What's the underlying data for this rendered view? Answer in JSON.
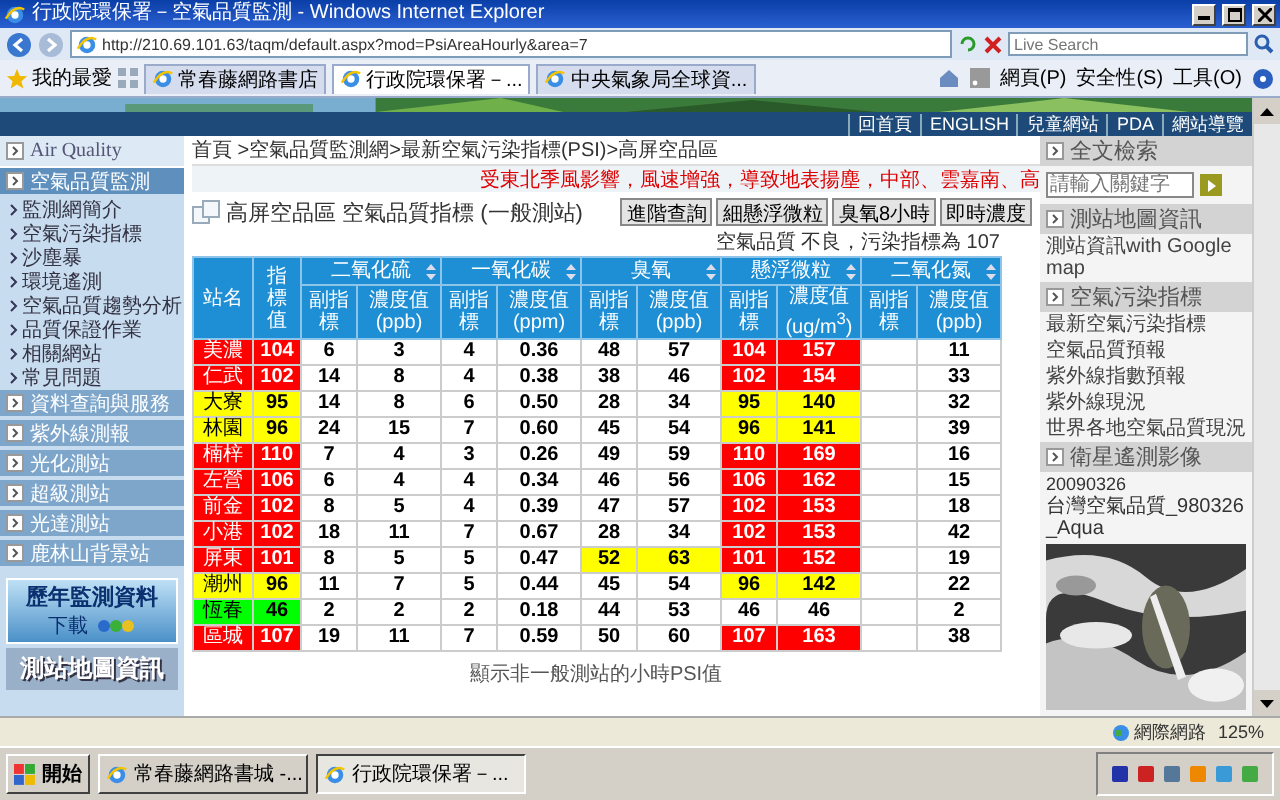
{
  "window": {
    "title": "行政院環保署－空氣品質監測 - Windows Internet Explorer"
  },
  "address_bar": {
    "url": "http://210.69.101.63/taqm/default.aspx?mod=PsiAreaHourly&area=7",
    "search_placeholder": "Live Search"
  },
  "favorites": {
    "label": "我的最愛"
  },
  "tabs": [
    {
      "label": "常春藤網路書店",
      "selected": false
    },
    {
      "label": "行政院環保署－...",
      "selected": true
    },
    {
      "label": "中央氣象局全球資...",
      "selected": false
    }
  ],
  "command_bar": [
    "網頁(P)",
    "安全性(S)",
    "工具(O)"
  ],
  "top_nav": [
    "回首頁",
    "ENGLISH",
    "兒童網站",
    "PDA",
    "網站導覽"
  ],
  "sidebar": {
    "title": "Air Quality",
    "items": [
      {
        "label": "空氣品質監測",
        "selected": true,
        "children": [
          "監測網簡介",
          "空氣污染指標",
          "沙塵暴",
          "環境遙測",
          "空氣品質趨勢分析",
          "品質保證作業",
          "相關網站",
          "常見問題"
        ]
      },
      {
        "label": "資料查詢與服務",
        "selected": false
      },
      {
        "label": "紫外線測報",
        "selected": false
      },
      {
        "label": "光化測站",
        "selected": false
      },
      {
        "label": "超級測站",
        "selected": false
      },
      {
        "label": "光達測站",
        "selected": false
      },
      {
        "label": "鹿林山背景站",
        "selected": false
      }
    ],
    "banners": [
      {
        "title": "歷年監測資料",
        "subtitle": "下載"
      },
      {
        "title": "測站地圖資訊"
      }
    ]
  },
  "breadcrumb": "首頁 >空氣品質監測網>最新空氣污染指標(PSI)>高屏空品區",
  "notice": "受東北季風影響，風速增強，導致地表揚塵，中部、雲嘉南、高",
  "heading": "高屏空品區 空氣品質指標 (一般測站)",
  "buttons": [
    "進階查詢",
    "細懸浮微粒",
    "臭氧8小時",
    "即時濃度"
  ],
  "summary": "空氣品質 不良，污染指標為 107",
  "table": {
    "station_header": "站名",
    "index_header": "指標值",
    "groups": [
      {
        "name": "二氧化硫",
        "sub_header": "副指標",
        "value_header": "濃度值",
        "unit": "(ppb)"
      },
      {
        "name": "一氧化碳",
        "sub_header": "副指標",
        "value_header": "濃度值",
        "unit": "(ppm)"
      },
      {
        "name": "臭氧",
        "sub_header": "副指標",
        "value_header": "濃度值",
        "unit": "(ppb)"
      },
      {
        "name": "懸浮微粒",
        "sub_header": "副指標",
        "value_header": "濃度值",
        "unit": "(ug/m$^{3}$)"
      },
      {
        "name": "二氧化氮",
        "sub_header": "副指標",
        "value_header": "濃度值",
        "unit": "(ppb)"
      }
    ],
    "rows": [
      {
        "station": "美濃",
        "index": "104",
        "color": "#ff0000",
        "pollutants": [
          {
            "sub": "6",
            "value": "3"
          },
          {
            "sub": "4",
            "value": "0.36"
          },
          {
            "sub": "48",
            "value": "57"
          },
          {
            "sub": "104",
            "value": "157",
            "color": "#ff0000"
          },
          {
            "value": "11"
          }
        ]
      },
      {
        "station": "仁武",
        "index": "102",
        "color": "#ff0000",
        "pollutants": [
          {
            "sub": "14",
            "value": "8"
          },
          {
            "sub": "4",
            "value": "0.38"
          },
          {
            "sub": "38",
            "value": "46"
          },
          {
            "sub": "102",
            "value": "154",
            "color": "#ff0000"
          },
          {
            "value": "33"
          }
        ]
      },
      {
        "station": "大寮",
        "index": "95",
        "color": "#ffff00",
        "pollutants": [
          {
            "sub": "14",
            "value": "8"
          },
          {
            "sub": "6",
            "value": "0.50"
          },
          {
            "sub": "28",
            "value": "34"
          },
          {
            "sub": "95",
            "value": "140",
            "color": "#ffff00"
          },
          {
            "value": "32"
          }
        ]
      },
      {
        "station": "林園",
        "index": "96",
        "color": "#ffff00",
        "pollutants": [
          {
            "sub": "24",
            "value": "15"
          },
          {
            "sub": "7",
            "value": "0.60"
          },
          {
            "sub": "45",
            "value": "54"
          },
          {
            "sub": "96",
            "value": "141",
            "color": "#ffff00"
          },
          {
            "value": "39"
          }
        ]
      },
      {
        "station": "楠梓",
        "index": "110",
        "color": "#ff0000",
        "pollutants": [
          {
            "sub": "7",
            "value": "4"
          },
          {
            "sub": "3",
            "value": "0.26"
          },
          {
            "sub": "49",
            "value": "59"
          },
          {
            "sub": "110",
            "value": "169",
            "color": "#ff0000"
          },
          {
            "value": "16"
          }
        ]
      },
      {
        "station": "左營",
        "index": "106",
        "color": "#ff0000",
        "pollutants": [
          {
            "sub": "6",
            "value": "4"
          },
          {
            "sub": "4",
            "value": "0.34"
          },
          {
            "sub": "46",
            "value": "56"
          },
          {
            "sub": "106",
            "value": "162",
            "color": "#ff0000"
          },
          {
            "value": "15"
          }
        ]
      },
      {
        "station": "前金",
        "index": "102",
        "color": "#ff0000",
        "pollutants": [
          {
            "sub": "8",
            "value": "5"
          },
          {
            "sub": "4",
            "value": "0.39"
          },
          {
            "sub": "47",
            "value": "57"
          },
          {
            "sub": "102",
            "value": "153",
            "color": "#ff0000"
          },
          {
            "value": "18"
          }
        ]
      },
      {
        "station": "小港",
        "index": "102",
        "color": "#ff0000",
        "pollutants": [
          {
            "sub": "18",
            "value": "11"
          },
          {
            "sub": "7",
            "value": "0.67"
          },
          {
            "sub": "28",
            "value": "34"
          },
          {
            "sub": "102",
            "value": "153",
            "color": "#ff0000"
          },
          {
            "value": "42"
          }
        ]
      },
      {
        "station": "屏東",
        "index": "101",
        "color": "#ff0000",
        "pollutants": [
          {
            "sub": "8",
            "value": "5"
          },
          {
            "sub": "5",
            "value": "0.47"
          },
          {
            "sub": "52",
            "value": "63",
            "color": "#ffff00"
          },
          {
            "sub": "101",
            "value": "152",
            "color": "#ff0000"
          },
          {
            "value": "19"
          }
        ]
      },
      {
        "station": "潮州",
        "index": "96",
        "color": "#ffff00",
        "pollutants": [
          {
            "sub": "11",
            "value": "7"
          },
          {
            "sub": "5",
            "value": "0.44"
          },
          {
            "sub": "45",
            "value": "54"
          },
          {
            "sub": "96",
            "value": "142",
            "color": "#ffff00"
          },
          {
            "value": "22"
          }
        ]
      },
      {
        "station": "恆春",
        "index": "46",
        "color": "#00ff00",
        "pollutants": [
          {
            "sub": "2",
            "value": "2"
          },
          {
            "sub": "2",
            "value": "0.18"
          },
          {
            "sub": "44",
            "value": "53"
          },
          {
            "sub": "46",
            "value": "46"
          },
          {
            "value": "2"
          }
        ]
      },
      {
        "station": "區城",
        "index": "107",
        "color": "#ff0000",
        "pollutants": [
          {
            "sub": "19",
            "value": "11"
          },
          {
            "sub": "7",
            "value": "0.59"
          },
          {
            "sub": "50",
            "value": "60"
          },
          {
            "sub": "107",
            "value": "163",
            "color": "#ff0000"
          },
          {
            "value": "38"
          }
        ]
      }
    ]
  },
  "footer_note": "顯示非一般測站的小時PSI值",
  "right_panel": {
    "search": {
      "title": "全文檢索",
      "placeholder": "請輸入關鍵字"
    },
    "map": {
      "title": "測站地圖資訊",
      "link": "測站資訊with Google map"
    },
    "psi": {
      "title": "空氣污染指標",
      "links": [
        "最新空氣污染指標",
        "空氣品質預報",
        "紫外線指數預報",
        "紫外線現況",
        "世界各地空氣品質現況"
      ]
    },
    "satellite": {
      "title": "衛星遙測影像",
      "date": "20090326",
      "caption": "台灣空氣品質_980326_Aqua"
    }
  },
  "status_bar": {
    "zone": "網際網路",
    "zoom": "125%"
  },
  "taskbar": {
    "start": "開始",
    "tasks": [
      {
        "label": "常春藤網路書城 -...",
        "selected": false
      },
      {
        "label": "行政院環保署－...",
        "selected": true
      }
    ]
  }
}
